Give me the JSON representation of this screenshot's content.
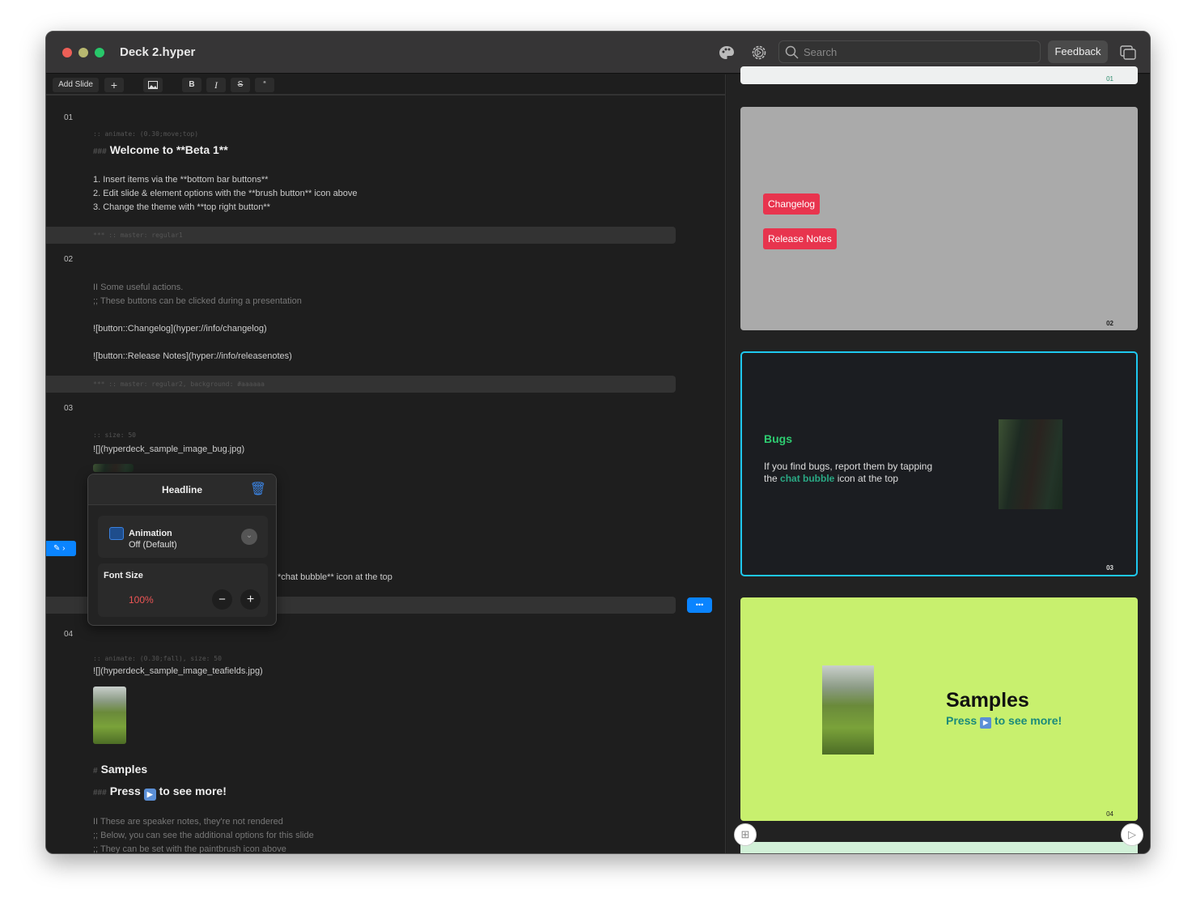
{
  "window": {
    "title": "Deck 2.hyper",
    "search_placeholder": "Search",
    "feedback_label": "Feedback"
  },
  "toolbar": {
    "add_slide": "Add Slide",
    "plus": "+",
    "bold": "B",
    "italic": "I",
    "strike": "S",
    "quote": "“"
  },
  "editor": {
    "slide1": {
      "num": "01",
      "code": ":: animate: (0.30;move;top)",
      "hash": "###",
      "heading": "Welcome to **Beta 1**",
      "lines": [
        "1. Insert items via the **bottom bar buttons**",
        "2. Edit slide & element options with the **brush button**  icon above",
        "3. Change the theme with  **top right button**"
      ],
      "sep": "*** :: master: regular1"
    },
    "slide2": {
      "num": "02",
      "note1": "II  Some useful actions.",
      "note2": ";; These buttons can be clicked during a presentation",
      "btn1": "![button::Changelog](hyper://info/changelog)",
      "btn2": "![button::Release Notes](hyper://info/releasenotes)",
      "sep": "*** :: master: regular2, background: #aaaaaa"
    },
    "slide3": {
      "num": "03",
      "code": ":: size: 50",
      "image": "![](hyperdeck_sample_image_bug.jpg)",
      "partial_line": "*chat bubble** icon at the top"
    },
    "slide4": {
      "num": "04",
      "code": ":: animate: (0.30;fall), size: 50",
      "image": "![](hyperdeck_sample_image_teafields.jpg)",
      "hash1": "#",
      "heading": "Samples",
      "hash2": "###",
      "sub_pre": "Press",
      "sub_post": "to see more!",
      "notes": [
        "II  These are speaker notes, they're not rendered",
        ";; Below, you can see the additional options for this slide",
        ";; They can be set with the paintbrush icon above"
      ]
    }
  },
  "popover": {
    "title": "Headline",
    "animation_label": "Animation",
    "animation_value": "Off (Default)",
    "font_size_label": "Font Size",
    "font_size_value": "100%",
    "minus": "−",
    "plus": "+"
  },
  "more_button": "•••",
  "preview": {
    "slide1_num": "01",
    "slide2": {
      "btn1": "Changelog",
      "btn2": "Release Notes",
      "num": "02"
    },
    "slide3": {
      "title": "Bugs",
      "text_pre": "If you find bugs, report them by tapping the ",
      "highlight": "chat bubble",
      "text_post": " icon at the top",
      "num": "03"
    },
    "slide4": {
      "title": "Samples",
      "sub_pre": "Press",
      "sub_post": "to see more!",
      "num": "04"
    }
  },
  "colors": {
    "accent": "#0a84ff",
    "selected_border": "#1ec8f0",
    "slide2_bg": "#aaaaaa",
    "slide4_bg": "#c8f06e",
    "green": "#2ecc71",
    "red": "#e8344e"
  }
}
